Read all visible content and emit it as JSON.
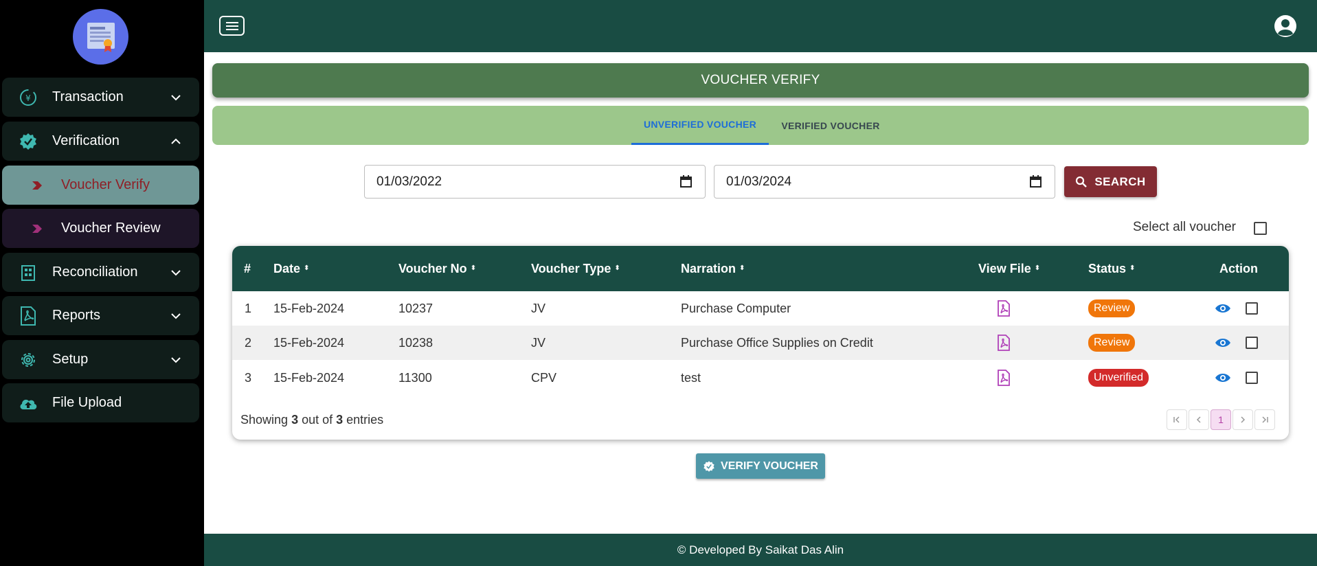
{
  "sidebar": {
    "items": [
      {
        "label": "Transaction",
        "icon": "currency-cycle-icon"
      },
      {
        "label": "Verification",
        "icon": "verified-badge-icon"
      },
      {
        "label": "Voucher Verify",
        "icon": "chevron-arrow-icon"
      },
      {
        "label": "Voucher Review",
        "icon": "chevron-arrow-icon"
      },
      {
        "label": "Reconciliation",
        "icon": "building-icon"
      },
      {
        "label": "Reports",
        "icon": "pdf-file-icon"
      },
      {
        "label": "Setup",
        "icon": "gear-icon"
      },
      {
        "label": "File Upload",
        "icon": "cloud-upload-icon"
      }
    ]
  },
  "header": {
    "title": "VOUCHER VERIFY"
  },
  "tabs": [
    {
      "label": "UNVERIFIED VOUCHER",
      "active": true
    },
    {
      "label": "VERIFIED VOUCHER",
      "active": false
    }
  ],
  "filters": {
    "from_date": "01/03/2022",
    "to_date": "01/03/2024",
    "search_label": "SEARCH",
    "select_all_label": "Select all voucher"
  },
  "table": {
    "columns": [
      "#",
      "Date",
      "Voucher No",
      "Voucher Type",
      "Narration",
      "View File",
      "Status",
      "Action"
    ],
    "rows": [
      {
        "num": "1",
        "date": "15-Feb-2024",
        "voucher_no": "10237",
        "type": "JV",
        "narration": "Purchase Computer",
        "status": "Review",
        "status_color": "#f0760a"
      },
      {
        "num": "2",
        "date": "15-Feb-2024",
        "voucher_no": "10238",
        "type": "JV",
        "narration": "Purchase Office Supplies on Credit",
        "status": "Review",
        "status_color": "#f0760a"
      },
      {
        "num": "3",
        "date": "15-Feb-2024",
        "voucher_no": "11300",
        "type": "CPV",
        "narration": "test",
        "status": "Unverified",
        "status_color": "#d32a2a"
      }
    ],
    "showing_prefix": "Showing ",
    "showing_count": "3",
    "showing_middle": " out of ",
    "showing_total": "3",
    "showing_suffix": " entries",
    "current_page": "1"
  },
  "verify_button_label": "VERIFY VOUCHER",
  "footer": {
    "text": "© Developed By Saikat Das Alin"
  },
  "colors": {
    "sidebar_bg": "#000000",
    "topbar": "#194c43",
    "title_bar": "#4e7a4f",
    "tabs_bar": "#9cc78b",
    "search_btn": "#832c33",
    "verify_btn": "#4f97a8",
    "icon_teal": "#3fb8b0",
    "pdf_purple": "#b040b8",
    "eye_blue": "#1976d2"
  }
}
